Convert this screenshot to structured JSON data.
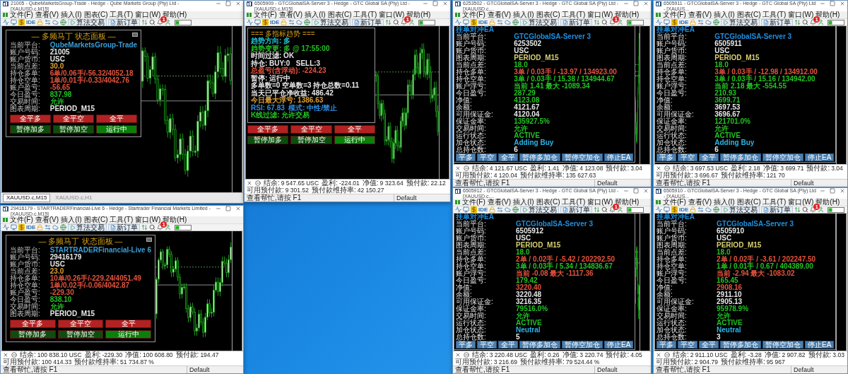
{
  "windows": [
    {
      "kind": "martingale",
      "title": "21005 - QubeMarketsGroup-Trade - Hedge - Qube Markets Group (Pty) Ltd - [XAUUSD.c,M15]",
      "menu": [
        "文件(F)",
        "查看(V)",
        "插入(I)",
        "图表(C)",
        "工具(T)",
        "窗口(W)",
        "帮助(H)"
      ],
      "toolbar": {
        "ide": "IDE",
        "algo": "算法交易",
        "new_order": "新订单",
        "alerts": "1"
      },
      "panel": {
        "title": "— 多频马丁 状态面板 —",
        "rows": [
          {
            "label": "当前平台:",
            "value": "QubeMarketsGroup-Trade",
            "color": "#3aa0d8"
          },
          {
            "label": "账户号码:",
            "value": "21005",
            "color": "#e8e8e8"
          },
          {
            "label": "账户货币:",
            "value": "USC",
            "color": "#e8e8e8"
          },
          {
            "label": "当前点差:",
            "value": "30.0",
            "color": "#e0a030"
          },
          {
            "label": "持仓多单:",
            "value": "6单/0.06手/-56.32/4052.18",
            "color": "#e5533d"
          },
          {
            "label": "持仓空单:",
            "value": "1单/0.01手/-0.33/4042.76",
            "color": "#e5533d"
          },
          {
            "label": "账户盈亏:",
            "value": "-56.65",
            "color": "#e5533d"
          },
          {
            "label": "今日盈亏:",
            "value": "837.98",
            "color": "#22c322"
          },
          {
            "label": "交易时间:",
            "value": "允许",
            "color": "#22c322"
          },
          {
            "label": "图表周期:",
            "value": "PERIOD_M15",
            "color": "#e8e8e8"
          }
        ],
        "buttons": [
          {
            "label": "全平多",
            "color": "#b22222"
          },
          {
            "label": "全平空",
            "color": "#b22222"
          },
          {
            "label": "全平",
            "color": "#b22222"
          },
          {
            "label": "暂停加多",
            "color": "#0d4d0d"
          },
          {
            "label": "暂停加空",
            "color": "#0d4d0d"
          },
          {
            "label": "运行中",
            "color": "#0a800a"
          }
        ]
      },
      "tabs": [
        {
          "label": "XAUUSD.c,M15",
          "selected": true
        },
        {
          "label": "XAUUSD.c,H1",
          "selected": false
        }
      ]
    },
    {
      "kind": "trend",
      "title": "6505909 - GTCGlobalSA-Server 3 - Hedge - GTC Global SA (Pty) Ltd - [XAUUSD.c,M15]",
      "menu": [
        "文件(F)",
        "查看(V)",
        "插入(I)",
        "图表(C)",
        "工具(T)",
        "窗口(W)",
        "帮助(H)"
      ],
      "toolbar": {
        "ide": "IDE",
        "algo": "算法交易",
        "new_order": "新订单",
        "alerts": "1"
      },
      "panel": {
        "title": "=== 多指标趋势 ===",
        "lines": [
          {
            "text": "趋势方向: 多",
            "color": "#1ec8d8"
          },
          {
            "text": "趋势变更: 多 @ 17:55:00",
            "color": "#22c322"
          },
          {
            "text": "时间过滤: OK",
            "color": "#e8e8e8"
          },
          {
            "text": "持仓: BUY:0   SELL:3",
            "color": "#e8e8e8"
          },
          {
            "text": "总盈亏(含浮动): -224.23",
            "color": "#e5533d"
          },
          {
            "text": "暂停: 运行中",
            "color": "#e8e8e8"
          },
          {
            "text": "多单数=0 空单数=3 持仓总数=0.11",
            "color": "#e8e8e8"
          },
          {
            "text": "当天已平仓净收益: 486.42",
            "color": "#e8e8e8"
          },
          {
            "text": "今日最大浮亏: 1386.63",
            "color": "#e0a030"
          },
          {
            "text": "RSI: 67.83  模式: 中性/禁止",
            "color": "#2e8fe6"
          },
          {
            "text": "K线过滤: 允许交易",
            "color": "#22c322"
          }
        ],
        "buttons": [
          {
            "label": "全平多",
            "color": "#b22222"
          },
          {
            "label": "全平空",
            "color": "#b22222"
          },
          {
            "label": "全平",
            "color": "#b22222"
          },
          {
            "label": "暂停加多",
            "color": "#0d4d0d"
          },
          {
            "label": "暂停加空",
            "color": "#0d4d0d"
          },
          {
            "label": "运行中",
            "color": "#0a800a"
          }
        ]
      },
      "status": [
        {
          "label": "结余:",
          "value": "9 547.65 USC"
        },
        {
          "label": "盈利:",
          "value": "-224.01"
        },
        {
          "label": "净值:",
          "value": "9 323.64"
        },
        {
          "label": "预付款:",
          "value": "22.12"
        },
        {
          "label": "可用预付款:",
          "value": "9 301.52"
        },
        {
          "label": "预付款维持率:",
          "value": "42 150.27"
        }
      ],
      "help": "查看帮忙,请按 F1",
      "profile": "Default"
    },
    {
      "kind": "hedge",
      "title": "6253502 - GTCGlobalSA-Server 3 - Hedge - GTC Global SA (Pty) Ltd - [XAUUSD.c,...",
      "menu": [
        "文件(F)",
        "查看(V)",
        "插入(I)",
        "图表(C)",
        "工具(T)",
        "窗口(W)",
        "帮助(H)"
      ],
      "toolbar": {
        "ide": "IDE",
        "algo": "算法交易",
        "new_order": "新订单",
        "alerts": "1"
      },
      "panel": {
        "title": "挂单对冲EA",
        "rows": [
          {
            "label": "当前平台:",
            "value": "GTCGlobalSA-Server 3",
            "color": "#1e8fe0"
          },
          {
            "label": "账户号码:",
            "value": "6253502",
            "color": "#e8e8e8"
          },
          {
            "label": "账户货币:",
            "value": "USC",
            "color": "#e8e8e8"
          },
          {
            "label": "图表周期:",
            "value": "PERIOD_M15",
            "color": "#d8d070"
          },
          {
            "label": "当前点差:",
            "value": "18.0",
            "color": "#22c322"
          },
          {
            "label": "持仓多单:",
            "value": "3单 / 0.03手 / -13.97 / 134923.00",
            "color": "#e5533d"
          },
          {
            "label": "持仓空单:",
            "value": "3单 / 0.03手 / 15.38 / 134944.67",
            "color": "#22c322"
          },
          {
            "label": "账户浮亏:",
            "value": "当前 1.41 最大 -1089.34",
            "color": "#22c322"
          },
          {
            "label": "今日盈亏:",
            "value": "287.29",
            "color": "#22c322"
          },
          {
            "label": "净值:",
            "value": "4123.08",
            "color": "#22c322"
          },
          {
            "label": "余额:",
            "value": "4121.67",
            "color": "#e8e8e8"
          },
          {
            "label": "可用保证金:",
            "value": "4120.04",
            "color": "#e8e8e8"
          },
          {
            "label": "保证金率:",
            "value": "135927.5%",
            "color": "#22c322"
          },
          {
            "label": "交易时间:",
            "value": "允许",
            "color": "#22c322"
          },
          {
            "label": "运行状态:",
            "value": "ACTIVE",
            "color": "#22c322"
          },
          {
            "label": "加仓状态:",
            "value": "Adding Buy",
            "color": "#29b6e8"
          },
          {
            "label": "总持仓数:",
            "value": "6",
            "color": "#e8e8e8"
          }
        ],
        "buttons": [
          {
            "label": "平多"
          },
          {
            "label": "平空"
          },
          {
            "label": "全平"
          },
          {
            "label": "暂停多加仓"
          },
          {
            "label": "暂停空加仓"
          },
          {
            "label": "停止EA"
          }
        ]
      },
      "status": [
        {
          "label": "结余:",
          "value": "4 121.67 USC"
        },
        {
          "label": "盈利:",
          "value": "1.41"
        },
        {
          "label": "净值:",
          "value": "4 123.08"
        },
        {
          "label": "预付款:",
          "value": "3.04"
        },
        {
          "label": "可用预付款:",
          "value": "4 120.04"
        },
        {
          "label": "预付款维持率:",
          "value": "135 627.63"
        }
      ],
      "help": "查看帮忙,请按 F1",
      "profile": "Default"
    },
    {
      "kind": "hedge",
      "title": "6505911 - GTCGlobalSA-Server 3 - Hedge - GTC Global SA (Pty) Ltd - [XAUUS...",
      "menu": [
        "文件(F)",
        "查看(V)",
        "插入(I)",
        "图表(C)",
        "工具(T)",
        "窗口(W)",
        "帮助(H)"
      ],
      "toolbar": {
        "ide": "IDE",
        "algo": "算法交易",
        "new_order": "新订单",
        "alerts": "1"
      },
      "panel": {
        "title": "挂单对冲EA",
        "rows": [
          {
            "label": "当前平台:",
            "value": "GTCGlobalSA-Server 3",
            "color": "#1e8fe0"
          },
          {
            "label": "账户号码:",
            "value": "6505911",
            "color": "#e8e8e8"
          },
          {
            "label": "账户货币:",
            "value": "USC",
            "color": "#e8e8e8"
          },
          {
            "label": "图表周期:",
            "value": "PERIOD_M15",
            "color": "#d8d070"
          },
          {
            "label": "当前点差:",
            "value": "18.0",
            "color": "#22c322"
          },
          {
            "label": "持仓多单:",
            "value": "3单 / 0.03手 / -12.98 / 134912.00",
            "color": "#e5533d"
          },
          {
            "label": "持仓空单:",
            "value": "3单 / 0.03手 / 15.16 / 134942.00",
            "color": "#22c322"
          },
          {
            "label": "账户浮亏:",
            "value": "当前 2.18 最大 -554.55",
            "color": "#22c322"
          },
          {
            "label": "今日盈亏:",
            "value": "210.93",
            "color": "#22c322"
          },
          {
            "label": "净值:",
            "value": "3699.71",
            "color": "#22c322"
          },
          {
            "label": "余额:",
            "value": "3697.53",
            "color": "#e8e8e8"
          },
          {
            "label": "可用保证金:",
            "value": "3696.67",
            "color": "#e8e8e8"
          },
          {
            "label": "保证金率:",
            "value": "121701.0%",
            "color": "#22c322"
          },
          {
            "label": "交易时间:",
            "value": "允许",
            "color": "#22c322"
          },
          {
            "label": "运行状态:",
            "value": "ACTIVE",
            "color": "#22c322"
          },
          {
            "label": "加仓状态:",
            "value": "Adding Buy",
            "color": "#29b6e8"
          },
          {
            "label": "总持仓数:",
            "value": "6",
            "color": "#e8e8e8"
          }
        ],
        "buttons": [
          {
            "label": "平多"
          },
          {
            "label": "平空"
          },
          {
            "label": "全平"
          },
          {
            "label": "暂停多加仓"
          },
          {
            "label": "暂停空加仓"
          },
          {
            "label": "停止EA"
          }
        ]
      },
      "status": [
        {
          "label": "结余:",
          "value": "3 697.53 USC"
        },
        {
          "label": "盈利:",
          "value": "2.18"
        },
        {
          "label": "净值:",
          "value": "3 699.71"
        },
        {
          "label": "预付款:",
          "value": "3.04"
        },
        {
          "label": "可用预付款:",
          "value": "3 696.67"
        },
        {
          "label": "预付款维持率:",
          "value": "121 70"
        }
      ],
      "help": "查看帮忙,请按 F1",
      "profile": "Default"
    },
    {
      "kind": "martingale",
      "title": "29416179 - STARTRADERFinancial-Live 6 - Hedge - Startrader Financial Markets Limited - [XAUUSD.c,M15]",
      "menu": [
        "文件(F)",
        "查看(V)",
        "插入(I)",
        "图表(C)",
        "工具(T)",
        "窗口(W)",
        "帮助(H)"
      ],
      "toolbar": {
        "ide": "IDE",
        "algo": "算法交易",
        "new_order": "新订单",
        "alerts": "1"
      },
      "panel": {
        "title": "— 多频马丁 状态面板 —",
        "rows": [
          {
            "label": "当前平台:",
            "value": "STARTRADERFinancial-Live 6",
            "color": "#3aa0d8"
          },
          {
            "label": "账户号码:",
            "value": "29416179",
            "color": "#e8e8e8"
          },
          {
            "label": "账户货币:",
            "value": "USC",
            "color": "#e8e8e8"
          },
          {
            "label": "当前点差:",
            "value": "23.0",
            "color": "#e0a030"
          },
          {
            "label": "持仓多单:",
            "value": "10单/0.26手/-229.24/4051.49",
            "color": "#e5533d"
          },
          {
            "label": "持仓空单:",
            "value": "1单/0.02手/-0.06/4042.87",
            "color": "#e5533d"
          },
          {
            "label": "账户盈亏:",
            "value": "-229.30",
            "color": "#e5533d"
          },
          {
            "label": "今日盈亏:",
            "value": "838.10",
            "color": "#22c322"
          },
          {
            "label": "交易时间:",
            "value": "允许",
            "color": "#22c322"
          },
          {
            "label": "图表周期:",
            "value": "PERIOD_M15",
            "color": "#e8e8e8"
          }
        ],
        "buttons": [
          {
            "label": "全平多",
            "color": "#b22222"
          },
          {
            "label": "全平空",
            "color": "#b22222"
          },
          {
            "label": "全平",
            "color": "#b22222"
          },
          {
            "label": "暂停加多",
            "color": "#0d4d0d"
          },
          {
            "label": "暂停加空",
            "color": "#0d4d0d"
          },
          {
            "label": "运行中",
            "color": "#0a800a"
          }
        ]
      },
      "status": [
        {
          "label": "结余:",
          "value": "100 838.10 USC"
        },
        {
          "label": "盈利:",
          "value": "-229.30"
        },
        {
          "label": "净值:",
          "value": "100 608.80"
        },
        {
          "label": "预付款:",
          "value": "194.47"
        },
        {
          "label": "可用预付款:",
          "value": "100 414.33"
        },
        {
          "label": "预付款维持率:",
          "value": "51 734.87 %"
        }
      ],
      "help": "查看帮忙,请按 F1",
      "profile": "Default"
    },
    {
      "kind": "hedge",
      "title": "6505912 - GTCGlobalSA-Server 3 - Hedge - GTC Global SA (Pty) Ltd - [XAUUSD.c,...",
      "menu": [
        "文件(F)",
        "查看(V)",
        "插入(I)",
        "图表(C)",
        "工具(T)",
        "窗口(W)",
        "帮助(H)"
      ],
      "toolbar": {
        "ide": "IDE",
        "algo": "算法交易",
        "new_order": "新订单",
        "alerts": "1"
      },
      "panel": {
        "title": "挂单对冲EA",
        "rows": [
          {
            "label": "当前平台:",
            "value": "GTCGlobalSA-Server 3",
            "color": "#1e8fe0"
          },
          {
            "label": "账户号码:",
            "value": "6505912",
            "color": "#e8e8e8"
          },
          {
            "label": "账户货币:",
            "value": "USC",
            "color": "#e8e8e8"
          },
          {
            "label": "图表周期:",
            "value": "PERIOD_M15",
            "color": "#d8d070"
          },
          {
            "label": "当前点差:",
            "value": "18.0",
            "color": "#22c322"
          },
          {
            "label": "持仓多单:",
            "value": "2单 / 0.02手 / -5.42 / 202292.50",
            "color": "#e5533d"
          },
          {
            "label": "持仓空单:",
            "value": "3单 / 0.03手 / 5.34 / 134836.67",
            "color": "#22c322"
          },
          {
            "label": "账户浮亏:",
            "value": "当前 -0.08 最大 -1117.36",
            "color": "#e5533d"
          },
          {
            "label": "今日盈亏:",
            "value": "179.42",
            "color": "#22c322"
          },
          {
            "label": "净值:",
            "value": "3220.40",
            "color": "#e5533d"
          },
          {
            "label": "余额:",
            "value": "3220.48",
            "color": "#e8e8e8"
          },
          {
            "label": "可用保证金:",
            "value": "3216.35",
            "color": "#e8e8e8"
          },
          {
            "label": "保证金率:",
            "value": "79516.0%",
            "color": "#22c322"
          },
          {
            "label": "交易时间:",
            "value": "允许",
            "color": "#22c322"
          },
          {
            "label": "运行状态:",
            "value": "ACTIVE",
            "color": "#22c322"
          },
          {
            "label": "加仓状态:",
            "value": "Neutral",
            "color": "#29b6e8"
          },
          {
            "label": "总持仓数:",
            "value": "5",
            "color": "#e8e8e8"
          }
        ],
        "buttons": [
          {
            "label": "平多"
          },
          {
            "label": "平空"
          },
          {
            "label": "全平"
          },
          {
            "label": "暂停多加仓"
          },
          {
            "label": "暂停空加仓"
          },
          {
            "label": "停止EA"
          }
        ]
      },
      "status": [
        {
          "label": "结余:",
          "value": "3 220.48 USC"
        },
        {
          "label": "盈利:",
          "value": "0.26"
        },
        {
          "label": "净值:",
          "value": "3 220.74"
        },
        {
          "label": "预付款:",
          "value": "4.05"
        },
        {
          "label": "可用预付款:",
          "value": "3 216.69"
        },
        {
          "label": "预付款维持率:",
          "value": "79 524.44 %"
        }
      ],
      "help": "查看帮忙,请按 F1",
      "profile": "Default"
    },
    {
      "kind": "hedge",
      "title": "6505910 - GTCGlobalSA-Server 3 - Hedge - GTC Global SA (Pty) Ltd - [XAUUS...",
      "menu": [
        "文件(F)",
        "查看(V)",
        "插入(I)",
        "图表(C)",
        "工具(T)",
        "窗口(W)",
        "帮助(H)"
      ],
      "toolbar": {
        "ide": "IDE",
        "algo": "算法交易",
        "new_order": "新订单",
        "alerts": "1"
      },
      "panel": {
        "title": "挂单对冲EA",
        "rows": [
          {
            "label": "当前平台:",
            "value": "GTCGlobalSA-Server 3",
            "color": "#1e8fe0"
          },
          {
            "label": "账户号码:",
            "value": "6505910",
            "color": "#e8e8e8"
          },
          {
            "label": "账户货币:",
            "value": "USC",
            "color": "#e8e8e8"
          },
          {
            "label": "图表周期:",
            "value": "PERIOD_M15",
            "color": "#d8d070"
          },
          {
            "label": "当前点差:",
            "value": "18.0",
            "color": "#22c322"
          },
          {
            "label": "持仓多单:",
            "value": "2单 / 0.02手 / -3.61 / 202247.50",
            "color": "#e5533d"
          },
          {
            "label": "持仓空单:",
            "value": "1单 / 0.01手 / 0.67 / 404389.00",
            "color": "#22c322"
          },
          {
            "label": "账户浮亏:",
            "value": "当前 -2.94 最大 -1083.02",
            "color": "#e5533d"
          },
          {
            "label": "今日盈亏:",
            "value": "165.45",
            "color": "#22c322"
          },
          {
            "label": "净值:",
            "value": "2908.16",
            "color": "#e5533d"
          },
          {
            "label": "余额:",
            "value": "2911.10",
            "color": "#e8e8e8"
          },
          {
            "label": "可用保证金:",
            "value": "2905.13",
            "color": "#e8e8e8"
          },
          {
            "label": "保证金率:",
            "value": "95978.9%",
            "color": "#22c322"
          },
          {
            "label": "交易时间:",
            "value": "允许",
            "color": "#22c322"
          },
          {
            "label": "运行状态:",
            "value": "ACTIVE",
            "color": "#22c322"
          },
          {
            "label": "加仓状态:",
            "value": "Neutral",
            "color": "#29b6e8"
          },
          {
            "label": "总持仓数:",
            "value": "3",
            "color": "#e8e8e8"
          }
        ],
        "buttons": [
          {
            "label": "平多"
          },
          {
            "label": "平空"
          },
          {
            "label": "全平"
          },
          {
            "label": "暂停多加仓"
          },
          {
            "label": "暂停空加仓"
          },
          {
            "label": "停止EA"
          }
        ]
      },
      "status": [
        {
          "label": "结余:",
          "value": "2 911.10 USC"
        },
        {
          "label": "盈利:",
          "value": "-3.28"
        },
        {
          "label": "净值:",
          "value": "2 907.82"
        },
        {
          "label": "预付款:",
          "value": "3.03"
        },
        {
          "label": "可用预付款:",
          "value": "2 904.79"
        },
        {
          "label": "预付款维持率:",
          "value": "95 967"
        }
      ],
      "help": "查看帮忙,请按 F1",
      "profile": "Default"
    }
  ]
}
